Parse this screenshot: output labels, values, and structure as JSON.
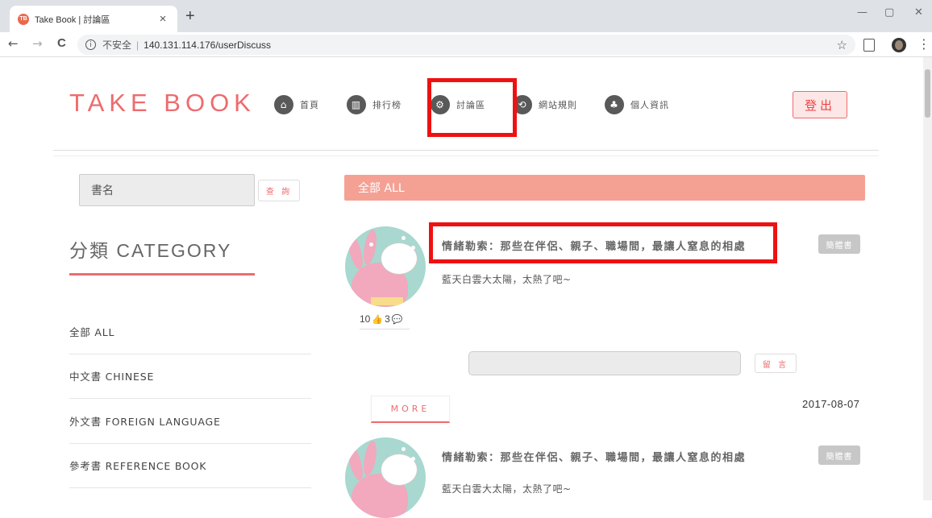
{
  "browser": {
    "tab_title": "Take Book | 討論區",
    "favicon_text": "TB",
    "tab_close": "×",
    "new_tab": "+",
    "win_min": "—",
    "win_max": "▢",
    "win_close": "✕",
    "back": "←",
    "forward": "→",
    "reload": "C",
    "info_icon": "i",
    "insecure_label": "不安全",
    "separator": "|",
    "url": "140.131.114.176/userDiscuss",
    "star": "☆",
    "kebab": "⋮"
  },
  "site": {
    "logo": "TAKE BOOK",
    "nav": [
      {
        "label": "首頁",
        "icon": "home-icon",
        "glyph": "⌂"
      },
      {
        "label": "排行榜",
        "icon": "bar-chart-icon",
        "glyph": "▥"
      },
      {
        "label": "討論區",
        "icon": "gear-icon",
        "glyph": "⚙"
      },
      {
        "label": "網站規則",
        "icon": "refresh-icon",
        "glyph": "⟲"
      },
      {
        "label": "個人資訊",
        "icon": "sitemap-icon",
        "glyph": "♣"
      }
    ],
    "logout": "登出"
  },
  "sidebar": {
    "search_value": "書名",
    "search_button": "查 詢",
    "category_title": "分類 CATEGORY",
    "categories": [
      "全部 ALL",
      "中文書 CHINESE",
      "外文書 FOREIGN LANGUAGE",
      "參考書 REFERENCE BOOK"
    ]
  },
  "main": {
    "header": "全部 ALL",
    "posts": [
      {
        "title": "情緒勒索：那些在伴侶、親子、職場間，最讓人窒息的相處",
        "body": "藍天白雲大太陽，太熱了吧~",
        "tag": "簡體書",
        "likes": "10",
        "like_icon": "👍",
        "comments": "3",
        "comment_icon": "💬",
        "comment_button": "留 言",
        "more": "MORE",
        "date": "2017-08-07"
      },
      {
        "title": "情緒勒索：那些在伴侶、親子、職場間，最讓人窒息的相處",
        "body": "藍天白雲大太陽，太熱了吧~",
        "tag": "簡體書"
      }
    ]
  },
  "colors": {
    "accent": "#ee6b6e",
    "header_bar": "#f4a194",
    "highlight": "#ee1111"
  }
}
